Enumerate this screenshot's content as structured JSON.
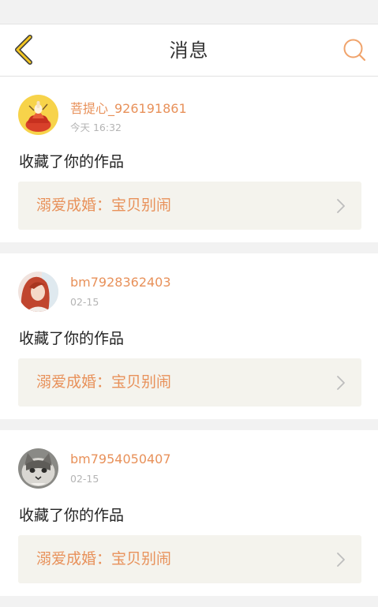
{
  "header": {
    "title": "消息",
    "back_icon": "chevron-left-icon",
    "search_icon": "search-icon",
    "accent_color": "#e8915a",
    "back_color": "#f3c622"
  },
  "messages": [
    {
      "username": "菩提心_926191861",
      "time": "今天 16:32",
      "action": "收藏了你的作品",
      "work_title": "溺爱成婚：宝贝别闹",
      "avatar_icon": "lotus-avatar-icon"
    },
    {
      "username": "bm7928362403",
      "time": "02-15",
      "action": "收藏了你的作品",
      "work_title": "溺爱成婚：宝贝别闹",
      "avatar_icon": "portrait-avatar-icon"
    },
    {
      "username": "bm7954050407",
      "time": "02-15",
      "action": "收藏了你的作品",
      "work_title": "溺爱成婚：宝贝别闹",
      "avatar_icon": "cat-avatar-icon"
    }
  ]
}
